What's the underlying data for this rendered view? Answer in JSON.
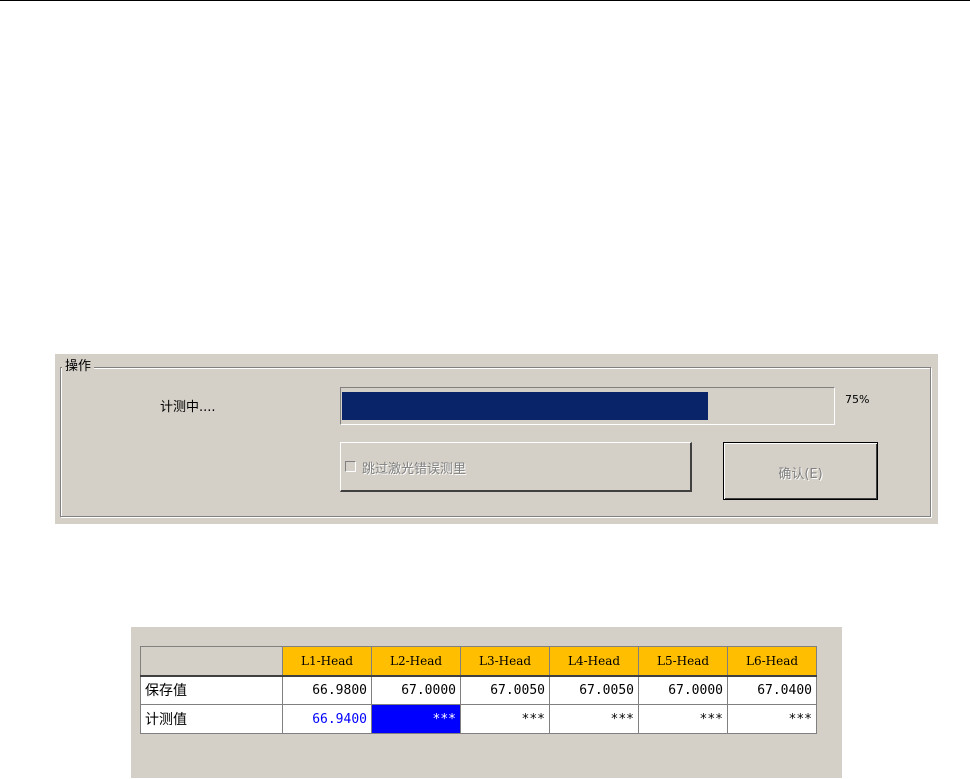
{
  "operation": {
    "group_title": "操作",
    "status_text": "计测中....",
    "progress": {
      "value": 75,
      "label": "75%"
    },
    "skip_checkbox": {
      "label": "跳过激光错误测里",
      "checked": false,
      "enabled": false
    },
    "confirm_button": {
      "label": "确认(E)",
      "enabled": false
    }
  },
  "table": {
    "headers": [
      "L1-Head",
      "L2-Head",
      "L3-Head",
      "L4-Head",
      "L5-Head",
      "L6-Head"
    ],
    "rows": [
      {
        "label": "保存值",
        "values": [
          "66.9800",
          "67.0000",
          "67.0050",
          "67.0050",
          "67.0000",
          "67.0400"
        ]
      },
      {
        "label": "计测值",
        "values": [
          "66.9400",
          "***",
          "***",
          "***",
          "***",
          "***"
        ]
      }
    ],
    "colors": {
      "header_bg": "#ffbe00",
      "measured_first_text": "#0000ff",
      "selected_cell_bg": "#0000ff",
      "selected_cell_text": "#ffffff"
    }
  },
  "colors": {
    "window_bg": "#d4d0c8",
    "progress_fill": "#0a246a"
  }
}
